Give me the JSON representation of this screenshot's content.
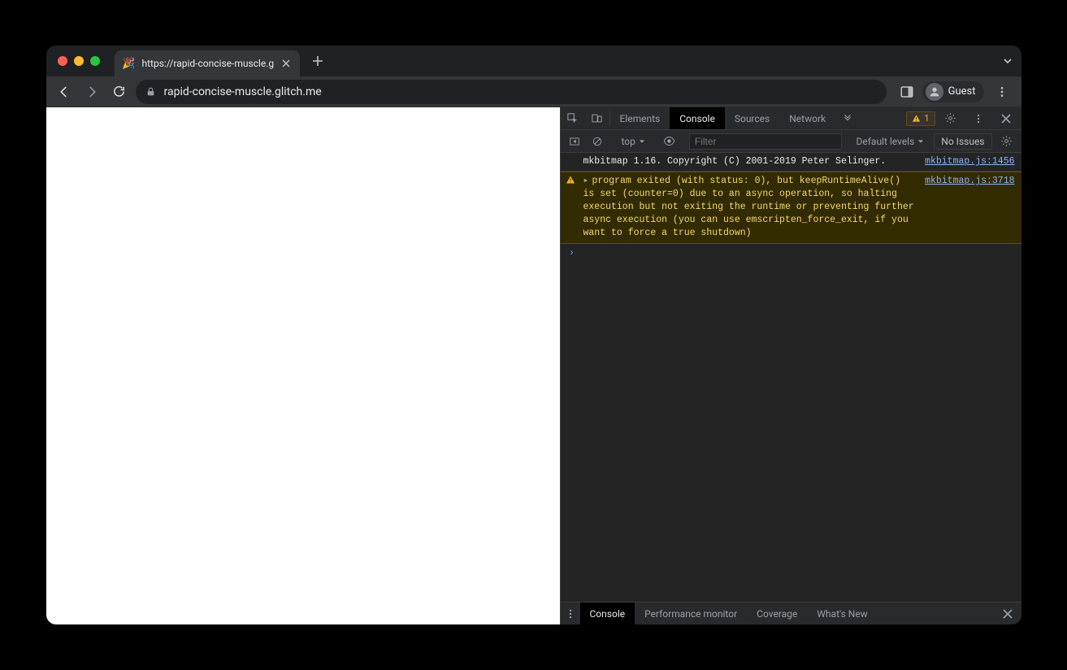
{
  "tab": {
    "title": "https://rapid-concise-muscle.g",
    "favicon": "🎉"
  },
  "toolbar": {
    "url": "rapid-concise-muscle.glitch.me",
    "profile_label": "Guest"
  },
  "devtools": {
    "tabs": {
      "elements": "Elements",
      "console": "Console",
      "sources": "Sources",
      "network": "Network"
    },
    "warn_count": "1",
    "console_toolbar": {
      "context": "top",
      "filter_placeholder": "Filter",
      "levels_label": "Default levels",
      "issues_label": "No Issues"
    },
    "messages": {
      "m1_text": "mkbitmap 1.16. Copyright (C) 2001-2019 Peter Selinger.",
      "m1_src": "mkbitmap.js:1456",
      "m2_text": "program exited (with status: 0), but keepRuntimeAlive() is set (counter=0) due to an async operation, so halting execution but not exiting the runtime or preventing further async execution (you can use emscripten_force_exit, if you want to force a true shutdown)",
      "m2_src": "mkbitmap.js:3718"
    },
    "drawer": {
      "console": "Console",
      "perfmon": "Performance monitor",
      "coverage": "Coverage",
      "whatsnew": "What's New"
    }
  }
}
